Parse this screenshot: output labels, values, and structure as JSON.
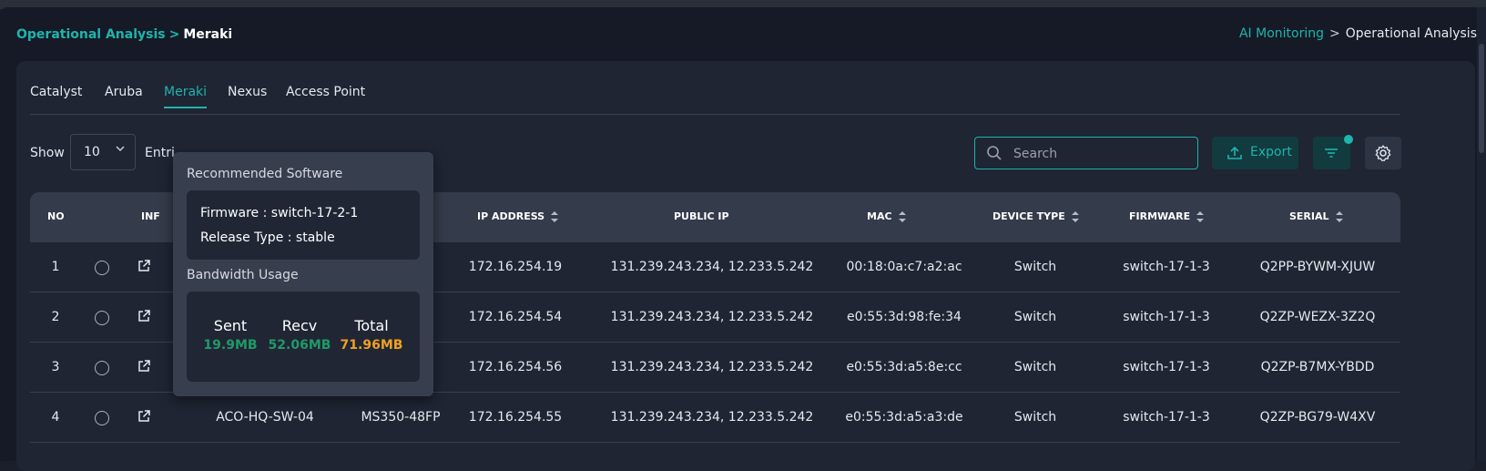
{
  "breadcrumb_left": {
    "link": "Operational Analysis",
    "sep": ">",
    "current": "Meraki"
  },
  "breadcrumb_right": {
    "link": "AI Monitoring",
    "sep": ">",
    "current": "Operational Analysis"
  },
  "tabs": [
    {
      "label": "Catalyst",
      "active": false
    },
    {
      "label": "Aruba",
      "active": false
    },
    {
      "label": "Meraki",
      "active": true
    },
    {
      "label": "Nexus",
      "active": false
    },
    {
      "label": "Access Point",
      "active": false
    }
  ],
  "toolbar": {
    "show_label": "Show",
    "page_size": "10",
    "entries_label": "Entri",
    "search_placeholder": "Search",
    "export_label": "Export"
  },
  "table": {
    "headers": {
      "no": "NO",
      "info": "INF",
      "ip": "IP ADDRESS",
      "public_ip": "PUBLIC IP",
      "mac": "MAC",
      "device_type": "DEVICE TYPE",
      "firmware": "FIRMWARE",
      "serial": "SERIAL"
    },
    "rows": [
      {
        "no": "1",
        "name": "",
        "model": "",
        "ip": "172.16.254.19",
        "public_ip": "131.239.243.234, 12.233.5.242",
        "mac": "00:18:0a:c7:a2:ac",
        "device_type": "Switch",
        "firmware": "switch-17-1-3",
        "serial": "Q2PP-BYWM-XJUW"
      },
      {
        "no": "2",
        "name": "",
        "model": "",
        "ip": "172.16.254.54",
        "public_ip": "131.239.243.234, 12.233.5.242",
        "mac": "e0:55:3d:98:fe:34",
        "device_type": "Switch",
        "firmware": "switch-17-1-3",
        "serial": "Q2ZP-WEZX-3Z2Q"
      },
      {
        "no": "3",
        "name": "",
        "model": "",
        "ip": "172.16.254.56",
        "public_ip": "131.239.243.234, 12.233.5.242",
        "mac": "e0:55:3d:a5:8e:cc",
        "device_type": "Switch",
        "firmware": "switch-17-1-3",
        "serial": "Q2ZP-B7MX-YBDD"
      },
      {
        "no": "4",
        "name": "ACO-HQ-SW-04",
        "model": "MS350-48FP",
        "ip": "172.16.254.55",
        "public_ip": "131.239.243.234, 12.233.5.242",
        "mac": "e0:55:3d:a5:a3:de",
        "device_type": "Switch",
        "firmware": "switch-17-1-3",
        "serial": "Q2ZP-BG79-W4XV"
      }
    ]
  },
  "popup": {
    "recommended_title": "Recommended Software",
    "firmware_line": "Firmware : switch-17-2-1",
    "release_line": "Release Type : stable",
    "bandwidth_title": "Bandwidth Usage",
    "sent_label": "Sent",
    "sent_value": "19.9MB",
    "recv_label": "Recv",
    "recv_value": "52.06MB",
    "total_label": "Total",
    "total_value": "71.96MB"
  },
  "colors": {
    "accent": "#1fb4ad",
    "sent": "#1f9a6a",
    "recv": "#1f9a6a",
    "total": "#f0a020"
  }
}
